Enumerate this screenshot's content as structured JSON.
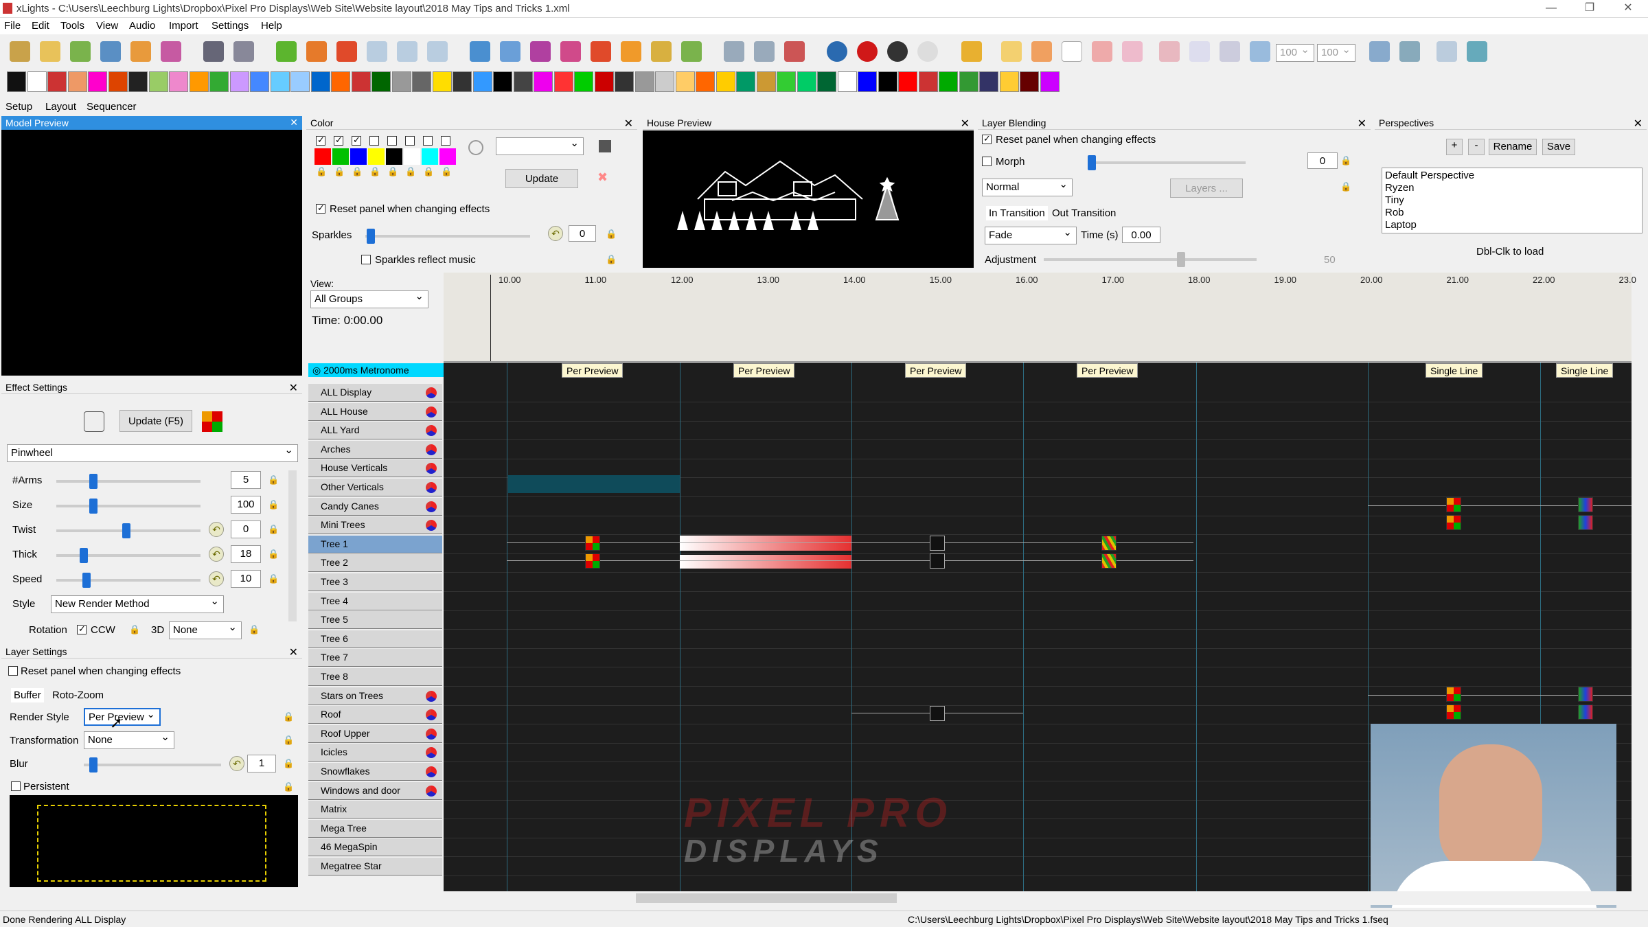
{
  "window": {
    "title": "xLights - C:\\Users\\Leechburg Lights\\Dropbox\\Pixel Pro Displays\\Web Site\\Website layout\\2018 May Tips and Tricks 1.xml"
  },
  "menu": [
    "File",
    "Edit",
    "Tools",
    "View",
    "Audio",
    "Import",
    "Settings",
    "Help"
  ],
  "toolbar": {
    "zoom1": "100",
    "zoom2": "100"
  },
  "tabs": [
    "Setup",
    "Layout",
    "Sequencer"
  ],
  "model_preview": {
    "title": "Model Preview"
  },
  "color": {
    "title": "Color",
    "update_label": "Update",
    "reset_label": "Reset panel when changing effects",
    "sparkles_label": "Sparkles",
    "sparkles_value": "0",
    "sparkles_reflect_label": "Sparkles reflect music",
    "palette": [
      "#ff0000",
      "#00c000",
      "#0000ff",
      "#ffff00",
      "#000000",
      "#ffffff",
      "#00ffff",
      "#ff00ff"
    ]
  },
  "house_preview": {
    "title": "House Preview"
  },
  "layer_blending": {
    "title": "Layer Blending",
    "reset_label": "Reset panel when changing effects",
    "morph_label": "Morph",
    "morph_value": "0",
    "mode": "Normal",
    "layers_label": "Layers ...",
    "in_tab": "In Transition",
    "out_tab": "Out Transition",
    "fade": "Fade",
    "time_label": "Time (s)",
    "time_value": "0.00",
    "adjust_label": "Adjustment",
    "adjust_value": "50"
  },
  "perspectives": {
    "title": "Perspectives",
    "plus": "+",
    "minus": "-",
    "rename": "Rename",
    "save": "Save",
    "items": [
      "Default Perspective",
      "Ryzen",
      "Tiny",
      "Rob",
      "Laptop"
    ],
    "hint": "Dbl-Clk to load"
  },
  "view": {
    "label": "View:",
    "value": "All Groups",
    "time": "Time: 0:00.00"
  },
  "timeline": {
    "ticks": [
      "10.00",
      "11.00",
      "12.00",
      "13.00",
      "14.00",
      "15.00",
      "16.00",
      "17.00",
      "18.00",
      "19.00",
      "20.00",
      "21.00",
      "22.00",
      "23.0"
    ]
  },
  "effect_settings": {
    "title": "Effect Settings",
    "update_label": "Update (F5)",
    "effect": "Pinwheel",
    "arms_label": "#Arms",
    "arms": "5",
    "size_label": "Size",
    "size": "100",
    "twist_label": "Twist",
    "twist": "0",
    "thick_label": "Thick",
    "thick": "18",
    "speed_label": "Speed",
    "speed": "10",
    "style_label": "Style",
    "style": "New Render Method",
    "rotation_label": "Rotation",
    "ccw_label": "CCW",
    "d3_label": "3D",
    "d3": "None"
  },
  "layer_settings": {
    "title": "Layer Settings",
    "reset_label": "Reset panel when changing effects",
    "tab_buffer": "Buffer",
    "tab_roto": "Roto-Zoom",
    "render_label": "Render Style",
    "render": "Per Preview",
    "transform_label": "Transformation",
    "transform": "None",
    "blur_label": "Blur",
    "blur": "1",
    "persistent_label": "Persistent"
  },
  "grid": {
    "metronome": "2000ms Metronome",
    "rows": [
      "ALL Display",
      "ALL House",
      "ALL Yard",
      "Arches",
      "House Verticals",
      "Other Verticals",
      "Candy Canes",
      "Mini Trees",
      "Tree 1",
      "Tree 2",
      "Tree 3",
      "Tree 4",
      "Tree 5",
      "Tree 6",
      "Tree 7",
      "Tree 8",
      "Stars on Trees",
      "Roof",
      "Roof Upper",
      "Icicles",
      "Snowflakes",
      "Windows and door",
      "Matrix",
      "Mega Tree",
      "46 MegaSpin",
      "Megatree Star"
    ],
    "group_icons": [
      true,
      true,
      true,
      true,
      true,
      true,
      true,
      true,
      false,
      false,
      false,
      false,
      false,
      false,
      false,
      false,
      true,
      true,
      true,
      true,
      true,
      true,
      false,
      false,
      false,
      false
    ],
    "labels": [
      "Per Preview",
      "Per Preview",
      "Per Preview",
      "Per Preview",
      "Single Line",
      "Single Line"
    ]
  },
  "watermark": {
    "line1": "PIXEL PRO",
    "line2": "DISPLAYS"
  },
  "status": {
    "left": "Done Rendering ALL Display",
    "right": "C:\\Users\\Leechburg Lights\\Dropbox\\Pixel Pro Displays\\Web Site\\Website layout\\2018 May Tips and Tricks 1.fseq"
  }
}
